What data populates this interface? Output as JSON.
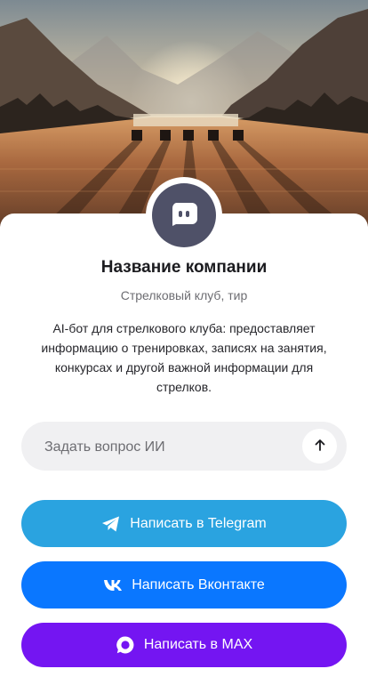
{
  "profile": {
    "name": "Название компании",
    "subtitle": "Стрелковый клуб, тир",
    "description": "AI-бот для стрелкового клуба: предоставляет информацию о тренировках, записях на занятия, конкурсах и другой важной информации для стрелков.",
    "avatar_icon": "chat-bot-icon"
  },
  "ask": {
    "placeholder": "Задать вопрос ИИ",
    "send_icon": "arrow-up-icon"
  },
  "actions": [
    {
      "label": "Написать в Telegram",
      "icon": "telegram-icon",
      "color": "#2aa3e0"
    },
    {
      "label": "Написать Вконтакте",
      "icon": "vk-icon",
      "color": "#0a77ff"
    },
    {
      "label": "Написать в MAX",
      "icon": "max-icon",
      "color": "#7415f2"
    }
  ],
  "hero": {
    "description_icon": "shooting-range-landscape-image"
  }
}
